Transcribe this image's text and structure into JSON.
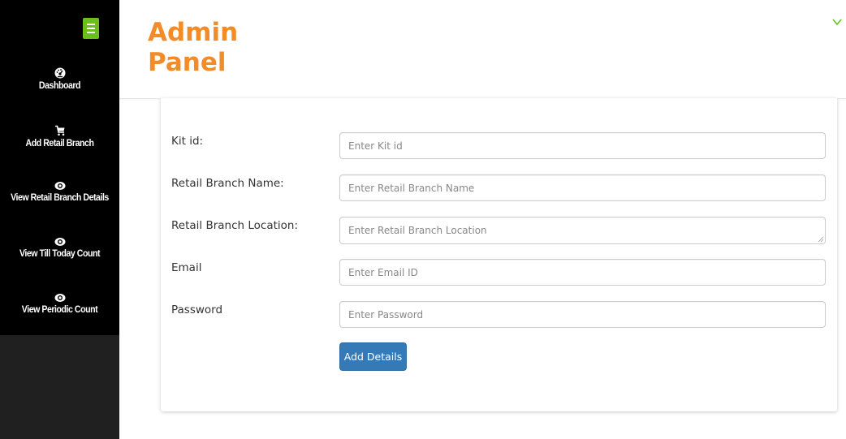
{
  "header": {
    "brand_line1": "Admin",
    "brand_line2": "Panel",
    "brand_color": "#f28c28"
  },
  "sidebar": {
    "toggle_icon": "menu-icon",
    "toggle_color": "#6cbe1e",
    "items": [
      {
        "label": "Dashboard",
        "icon": "dashboard-icon"
      },
      {
        "label": "Add Retail Branch",
        "icon": "cart-icon"
      },
      {
        "label": "View Retail Branch Details",
        "icon": "eye-icon"
      },
      {
        "label": "View Till Today Count",
        "icon": "eye-icon"
      },
      {
        "label": "View Periodic Count",
        "icon": "eye-icon"
      }
    ]
  },
  "form": {
    "fields": [
      {
        "label": "Kit id:",
        "placeholder": "Enter Kit id",
        "value": ""
      },
      {
        "label": "Retail Branch Name:",
        "placeholder": "Enter Retail Branch Name",
        "value": ""
      },
      {
        "label": "Retail Branch Location:",
        "placeholder": "Enter Retail Branch Location",
        "value": ""
      },
      {
        "label": "Email",
        "placeholder": "Enter Email ID",
        "value": ""
      },
      {
        "label": "Password",
        "placeholder": "Enter Password",
        "value": ""
      }
    ],
    "submit_label": "Add Details",
    "submit_color": "#337ab7"
  }
}
